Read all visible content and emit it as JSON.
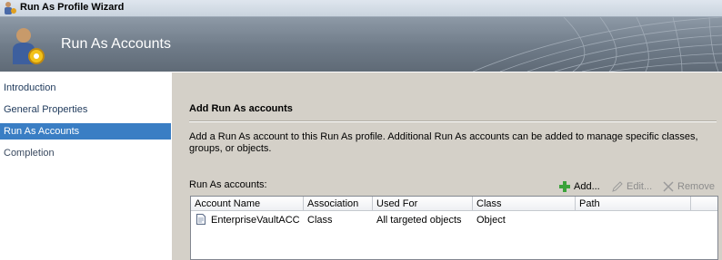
{
  "window": {
    "title": "Run As Profile Wizard"
  },
  "banner": {
    "title": "Run As Accounts"
  },
  "nav": {
    "items": [
      {
        "label": "Introduction"
      },
      {
        "label": "General Properties"
      },
      {
        "label": "Run As Accounts",
        "active": true
      },
      {
        "label": "Completion"
      }
    ]
  },
  "main": {
    "section_title": "Add Run As accounts",
    "description": "Add a Run As account to this Run As profile.  Additional Run As accounts can be added to manage specific classes, groups, or objects.",
    "accounts_label": "Run As accounts:",
    "toolbar": {
      "add_label": "Add...",
      "edit_label": "Edit...",
      "remove_label": "Remove"
    },
    "table": {
      "columns": [
        "Account Name",
        "Association",
        "Used For",
        "Class",
        "Path"
      ],
      "rows": [
        {
          "account_name": "EnterpriseVaultACC",
          "association": "Class",
          "used_for": "All targeted objects",
          "class": "Object",
          "path": ""
        }
      ]
    }
  },
  "colors": {
    "accent": "#3a7ec4",
    "add_icon": "#3aa23a",
    "content_bg": "#d4d0c8"
  },
  "icons": [
    "wizard-icon",
    "user-gear-icon",
    "add-icon",
    "edit-icon",
    "remove-icon",
    "document-icon"
  ]
}
